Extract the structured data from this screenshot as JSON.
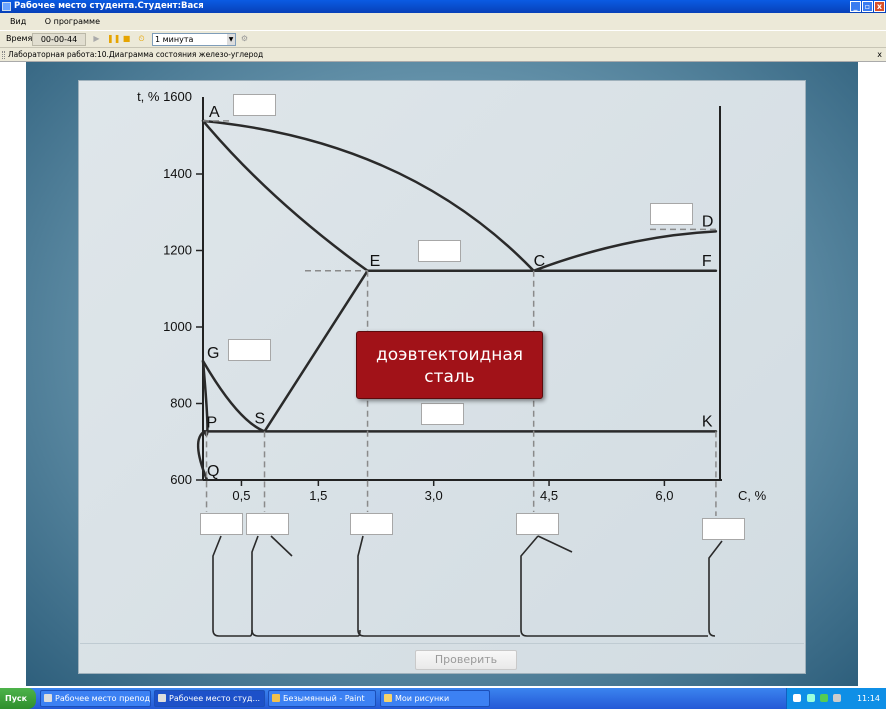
{
  "window": {
    "title": "Рабочее место студента.Студент:Вася",
    "controls": [
      "_",
      "▫",
      "x"
    ]
  },
  "menu": {
    "items": [
      "Вид",
      "О программе"
    ]
  },
  "toolbar": {
    "time_label": "Время",
    "time_value": "00-00-44",
    "interval": "1 минута"
  },
  "workbar": {
    "title": "Лабораторная работа:10.Диаграмма состояния железо-углерод",
    "close": "x"
  },
  "chart_data": {
    "type": "line",
    "ylabel": "t, % 1600",
    "xlabel": "C, %",
    "yticks": [
      "1400",
      "1200",
      "1000",
      "800",
      "600"
    ],
    "xticks": [
      "0,5",
      "1,5",
      "3,0",
      "4,5",
      "6,0"
    ],
    "points": {
      "A": {
        "label": "A",
        "x": 0.0,
        "y": 1539
      },
      "D": {
        "label": "D",
        "x": 6.67,
        "y": 1250
      },
      "E": {
        "label": "E",
        "x": 2.14,
        "y": 1147
      },
      "C": {
        "label": "C",
        "x": 4.3,
        "y": 1147
      },
      "F": {
        "label": "F",
        "x": 6.67,
        "y": 1147
      },
      "G": {
        "label": "G",
        "x": 0.0,
        "y": 911
      },
      "P": {
        "label": "P",
        "x": 0.02,
        "y": 727
      },
      "S": {
        "label": "S",
        "x": 0.8,
        "y": 727
      },
      "K": {
        "label": "K",
        "x": 6.67,
        "y": 727
      },
      "Q": {
        "label": "Q",
        "x": 0.0,
        "y": 600
      }
    }
  },
  "popup": {
    "line1": "доэвтектоидная",
    "line2": "сталь"
  },
  "check_button": {
    "label": "Проверить"
  },
  "taskbar": {
    "start": "Пуск",
    "tasks": [
      "Рабочее место препода...",
      "Рабочее место студ...",
      "Безымянный - Paint",
      "Мои рисунки"
    ],
    "clock": "11:14"
  }
}
